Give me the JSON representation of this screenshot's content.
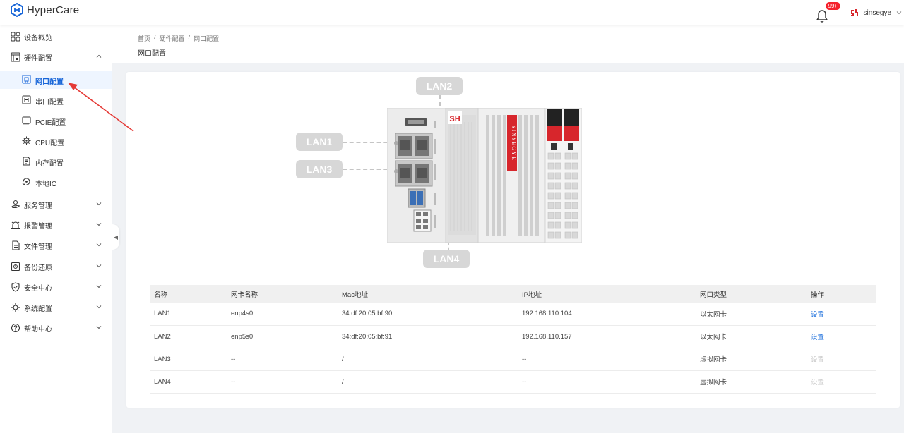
{
  "app": {
    "name": "HyperCare"
  },
  "header": {
    "notification_badge": "99+",
    "username": "sinsegye"
  },
  "sidebar": {
    "items": [
      {
        "label": "设备概览",
        "icon": "grid-icon"
      },
      {
        "label": "硬件配置",
        "icon": "hardware-icon",
        "expanded": true
      },
      {
        "label": "服务管理",
        "icon": "service-icon"
      },
      {
        "label": "报警管理",
        "icon": "alarm-icon"
      },
      {
        "label": "文件管理",
        "icon": "file-icon"
      },
      {
        "label": "备份还原",
        "icon": "backup-icon"
      },
      {
        "label": "安全中心",
        "icon": "shield-icon"
      },
      {
        "label": "系统配置",
        "icon": "system-icon"
      },
      {
        "label": "帮助中心",
        "icon": "help-icon"
      }
    ],
    "hardware_children": [
      {
        "label": "网口配置",
        "active": true
      },
      {
        "label": "串口配置"
      },
      {
        "label": "PCIE配置"
      },
      {
        "label": "CPU配置"
      },
      {
        "label": "内存配置"
      },
      {
        "label": "本地IO"
      }
    ]
  },
  "breadcrumb": [
    "首页",
    "硬件配置",
    "网口配置"
  ],
  "breadcrumb_sep": "/",
  "page_title": "网口配置",
  "device": {
    "lan_labels": [
      "LAN1",
      "LAN2",
      "LAN3",
      "LAN4"
    ],
    "brand_text": "SINSEGYE",
    "logo_text": "SH"
  },
  "table": {
    "columns": [
      "名称",
      "网卡名称",
      "Mac地址",
      "IP地址",
      "网口类型",
      "操作"
    ],
    "rows": [
      {
        "name": "LAN1",
        "nic": "enp4s0",
        "mac": "34:df:20:05:bf:90",
        "ip": "192.168.110.104",
        "type": "以太网卡",
        "action": "设置",
        "enabled": true
      },
      {
        "name": "LAN2",
        "nic": "enp5s0",
        "mac": "34:df:20:05:bf:91",
        "ip": "192.168.110.157",
        "type": "以太网卡",
        "action": "设置",
        "enabled": true
      },
      {
        "name": "LAN3",
        "nic": "--",
        "mac": "/",
        "ip": "--",
        "type": "虚拟网卡",
        "action": "设置",
        "enabled": false
      },
      {
        "name": "LAN4",
        "nic": "--",
        "mac": "/",
        "ip": "--",
        "type": "虚拟网卡",
        "action": "设置",
        "enabled": false
      }
    ]
  },
  "colors": {
    "accent": "#1765d8",
    "annotation_arrow": "#e53935",
    "brand_red": "#d7262c"
  }
}
